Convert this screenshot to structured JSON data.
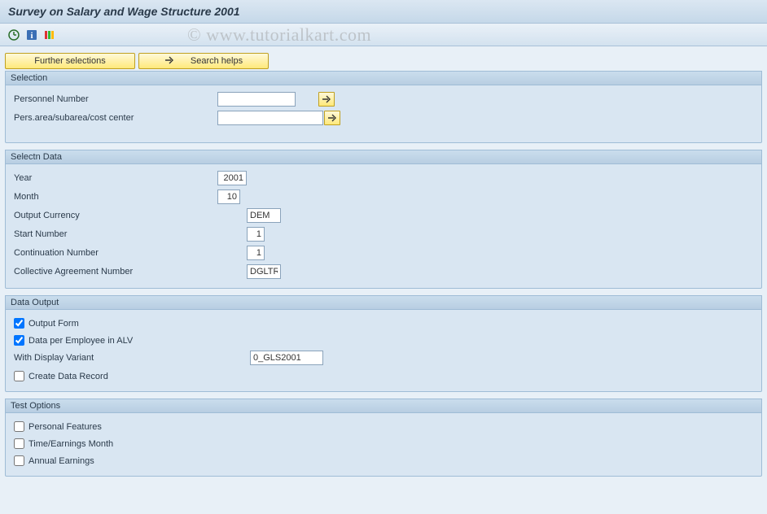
{
  "title": "Survey on Salary and Wage Structure 2001",
  "watermark": "© www.tutorialkart.com",
  "buttons": {
    "further_selections": "Further selections",
    "search_helps": "Search helps"
  },
  "groups": {
    "selection": {
      "header": "Selection",
      "personnel_number": {
        "label": "Personnel Number",
        "value": ""
      },
      "pers_area": {
        "label": "Pers.area/subarea/cost center",
        "value": ""
      }
    },
    "selectn_data": {
      "header": "Selectn Data",
      "year": {
        "label": "Year",
        "value": "2001"
      },
      "month": {
        "label": "Month",
        "value": "10"
      },
      "output_currency": {
        "label": "Output Currency",
        "value": "DEM"
      },
      "start_number": {
        "label": "Start Number",
        "value": "1"
      },
      "continuation_number": {
        "label": "Continuation Number",
        "value": "1"
      },
      "collective_agreement": {
        "label": "Collective Agreement Number",
        "value": "DGLTR"
      }
    },
    "data_output": {
      "header": "Data Output",
      "output_form": {
        "label": "Output Form",
        "checked": true
      },
      "data_per_employee": {
        "label": "Data per Employee in ALV",
        "checked": true
      },
      "display_variant": {
        "label": "With Display Variant",
        "value": "0_GLS2001"
      },
      "create_data_record": {
        "label": "Create Data Record",
        "checked": false
      }
    },
    "test_options": {
      "header": "Test Options",
      "personal_features": {
        "label": "Personal Features",
        "checked": false
      },
      "time_earnings": {
        "label": "Time/Earnings Month",
        "checked": false
      },
      "annual_earnings": {
        "label": "Annual Earnings",
        "checked": false
      }
    }
  }
}
